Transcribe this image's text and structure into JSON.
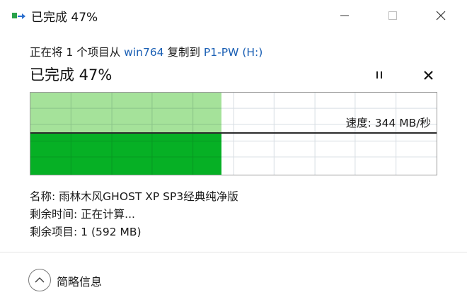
{
  "window": {
    "title": "已完成 47%"
  },
  "copy": {
    "prefix": "正在将 1 个项目从 ",
    "source": "win764",
    "middle": " 复制到 ",
    "destination": "P1-PW  (H:)"
  },
  "progress": {
    "title": "已完成 47%",
    "percent": 47,
    "speed_text": "速度: 344 MB/秒"
  },
  "details": {
    "name": "名称: 雨林木风GHOST XP SP3经典纯净版",
    "time_remaining": "剩余时间: 正在计算...",
    "items_remaining": "剩余项目: 1 (592 MB)",
    "toggle_label": "简略信息"
  },
  "colors": {
    "progress_fill": "#06b025",
    "progress_history": "#a5e29a",
    "link": "#1a5fb4"
  },
  "icons": {
    "app": "file-copy-icon",
    "minimize": "minimize-icon",
    "maximize": "maximize-icon",
    "close": "close-icon",
    "pause": "pause-icon",
    "cancel": "cancel-icon",
    "toggle": "chevron-up-icon"
  }
}
